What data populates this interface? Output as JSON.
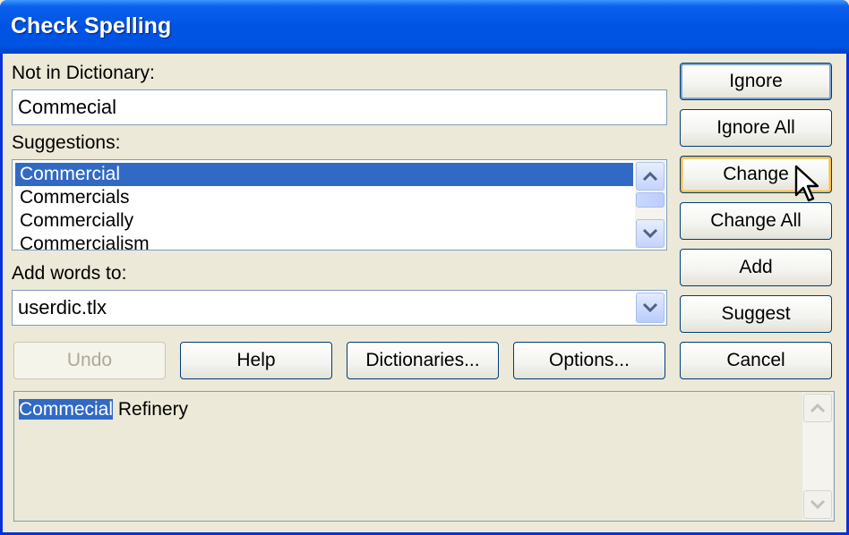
{
  "window": {
    "title": "Check Spelling"
  },
  "not_in_dictionary": {
    "label": "Not in Dictionary:",
    "value": "Commecial"
  },
  "suggestions": {
    "label": "Suggestions:",
    "items": [
      "Commercial",
      "Commercials",
      "Commercially",
      "Commercialism"
    ],
    "selected_index": 0
  },
  "add_words_to": {
    "label": "Add words to:",
    "value": "userdic.tlx"
  },
  "buttons": {
    "ignore": "Ignore",
    "ignore_all": "Ignore All",
    "change": "Change",
    "change_all": "Change All",
    "add": "Add",
    "suggest": "Suggest",
    "undo": "Undo",
    "help": "Help",
    "dictionaries": "Dictionaries...",
    "options": "Options...",
    "cancel": "Cancel"
  },
  "context": {
    "highlighted_word": "Commecial",
    "rest": " Refinery"
  },
  "icons": {
    "scroll_up": "chevron-up-icon",
    "scroll_down": "chevron-down-icon",
    "dropdown": "chevron-down-icon",
    "cursor": "mouse-pointer-icon"
  },
  "colors": {
    "title_bar": "#0054e3",
    "selection": "#316ac5",
    "dialog_bg": "#ece9d8"
  }
}
